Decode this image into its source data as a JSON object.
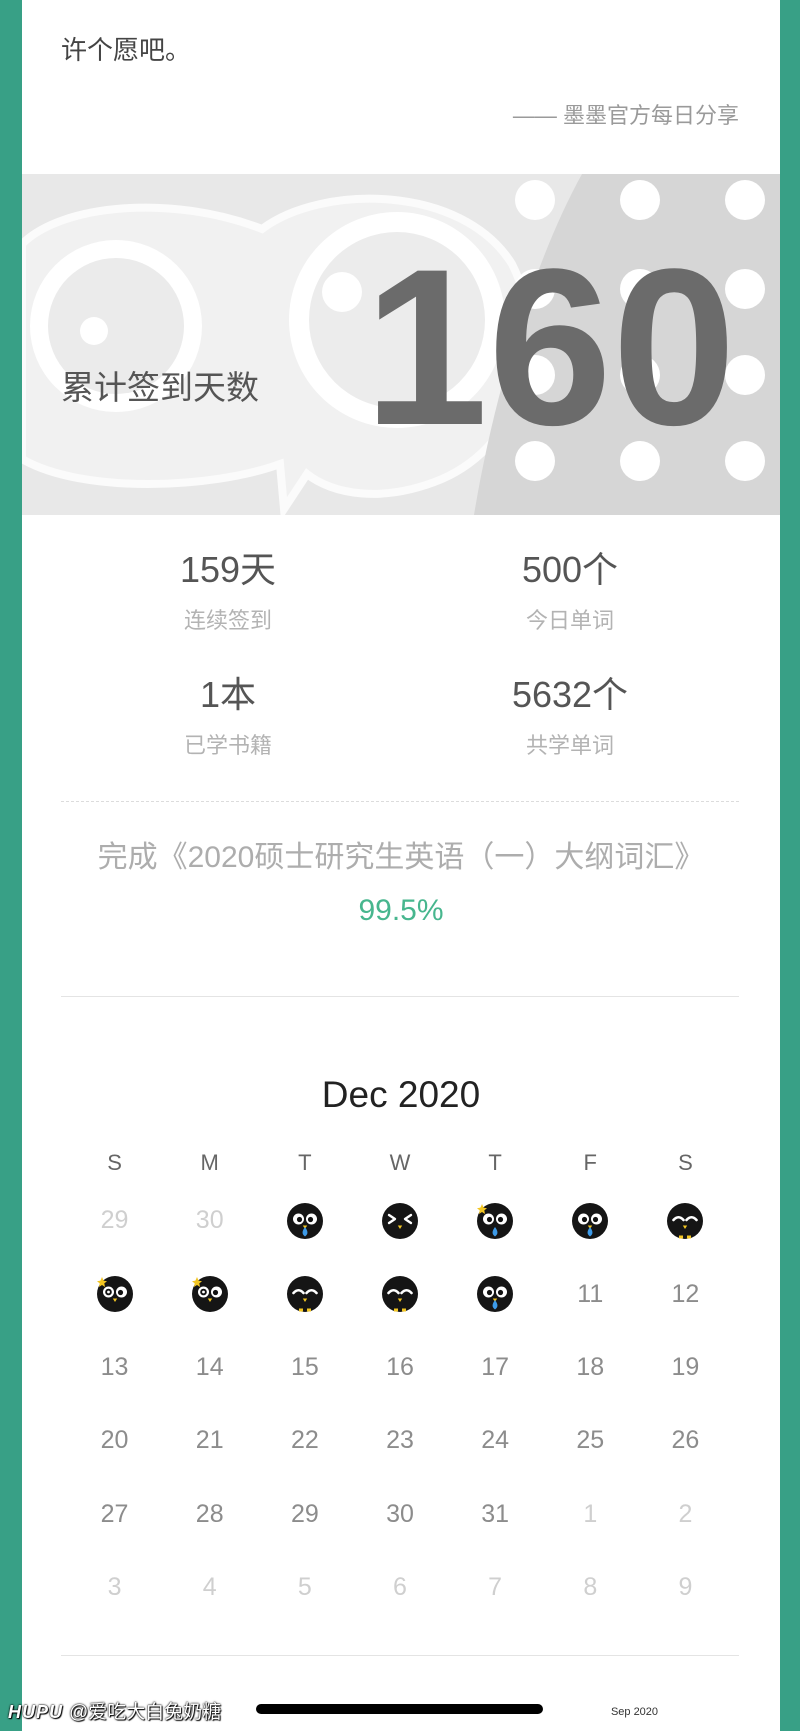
{
  "colors": {
    "frame": "#38a086",
    "accent": "#47b68e",
    "big_number": "#6b6b6b"
  },
  "quote": {
    "text": "许个愿吧。",
    "source": "—— 墨墨官方每日分享"
  },
  "banner": {
    "label": "累计签到天数",
    "total_days": "160"
  },
  "stats": [
    {
      "value": "159天",
      "label": "连续签到"
    },
    {
      "value": "500个",
      "label": "今日单词"
    },
    {
      "value": "1本",
      "label": "已学书籍"
    },
    {
      "value": "5632个",
      "label": "共学单词"
    }
  ],
  "progress": {
    "text": "完成《2020硕士研究生英语（一）大纲词汇》",
    "percent": "99.5%"
  },
  "calendar": {
    "month": "Dec 2020",
    "weekdays": [
      "S",
      "M",
      "T",
      "W",
      "T",
      "F",
      "S"
    ],
    "weeks": [
      [
        {
          "text": "29",
          "muted": true
        },
        {
          "text": "30",
          "muted": true
        },
        {
          "icon": "owl-drool-icon"
        },
        {
          "icon": "owl-squint-icon"
        },
        {
          "icon": "owl-sparkle-drool-icon"
        },
        {
          "icon": "owl-drool-icon"
        },
        {
          "icon": "owl-sleepy-icon"
        }
      ],
      [
        {
          "icon": "owl-sparkle-wink-icon"
        },
        {
          "icon": "owl-sparkle-wink-icon"
        },
        {
          "icon": "owl-sleepy-icon"
        },
        {
          "icon": "owl-sleepy-icon"
        },
        {
          "icon": "owl-drool-icon"
        },
        {
          "text": "11"
        },
        {
          "text": "12"
        }
      ],
      [
        {
          "text": "13"
        },
        {
          "text": "14"
        },
        {
          "text": "15"
        },
        {
          "text": "16"
        },
        {
          "text": "17"
        },
        {
          "text": "18"
        },
        {
          "text": "19"
        }
      ],
      [
        {
          "text": "20"
        },
        {
          "text": "21"
        },
        {
          "text": "22"
        },
        {
          "text": "23"
        },
        {
          "text": "24"
        },
        {
          "text": "25"
        },
        {
          "text": "26"
        }
      ],
      [
        {
          "text": "27"
        },
        {
          "text": "28"
        },
        {
          "text": "29"
        },
        {
          "text": "30"
        },
        {
          "text": "31"
        },
        {
          "text": "1",
          "muted": true
        },
        {
          "text": "2",
          "muted": true
        }
      ],
      [
        {
          "text": "3",
          "muted": true
        },
        {
          "text": "4",
          "muted": true
        },
        {
          "text": "5",
          "muted": true
        },
        {
          "text": "6",
          "muted": true
        },
        {
          "text": "7",
          "muted": true
        },
        {
          "text": "8",
          "muted": true
        },
        {
          "text": "9",
          "muted": true
        }
      ]
    ]
  },
  "footer": {
    "month_label": "Sep 2020"
  },
  "watermark": {
    "brand": "HUPU",
    "user": "@爱吃大白兔奶糖"
  }
}
